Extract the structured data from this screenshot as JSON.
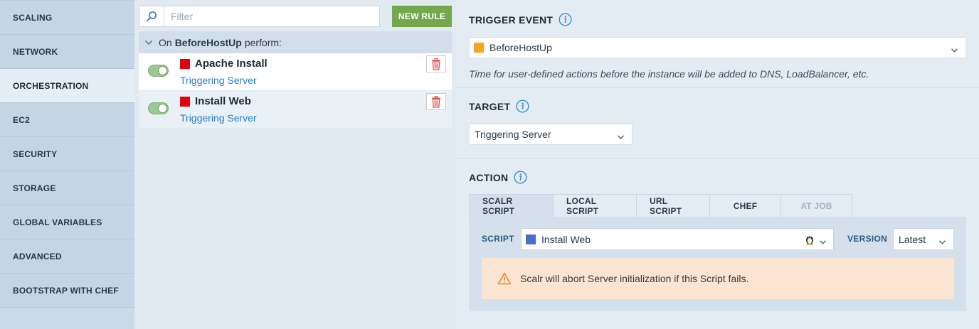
{
  "sidebar": {
    "items": [
      {
        "label": "SCALING"
      },
      {
        "label": "NETWORK"
      },
      {
        "label": "ORCHESTRATION"
      },
      {
        "label": "EC2"
      },
      {
        "label": "SECURITY"
      },
      {
        "label": "STORAGE"
      },
      {
        "label": "GLOBAL VARIABLES"
      },
      {
        "label": "ADVANCED"
      },
      {
        "label": "BOOTSTRAP WITH CHEF"
      }
    ],
    "active_index": 2
  },
  "rules_panel": {
    "filter_placeholder": "Filter",
    "new_rule_label": "NEW RULE",
    "header_prefix": "On",
    "header_event": "BeforeHostUp",
    "header_suffix": "perform:",
    "rules": [
      {
        "name": "Apache Install",
        "target": "Triggering Server",
        "enabled": true,
        "color": "#e0000f"
      },
      {
        "name": "Install Web",
        "target": "Triggering Server",
        "enabled": true,
        "color": "#e0000f"
      }
    ]
  },
  "trigger_event": {
    "title": "TRIGGER EVENT",
    "selected": "BeforeHostUp",
    "color": "#f5a51c",
    "description": "Time for user-defined actions before the instance will be added to DNS, LoadBalancer, etc."
  },
  "target": {
    "title": "TARGET",
    "selected": "Triggering Server"
  },
  "action": {
    "title": "ACTION",
    "tabs": [
      {
        "label": "SCALR SCRIPT",
        "active": true,
        "disabled": false
      },
      {
        "label": "LOCAL SCRIPT",
        "active": false,
        "disabled": false
      },
      {
        "label": "URL SCRIPT",
        "active": false,
        "disabled": false
      },
      {
        "label": "CHEF",
        "active": false,
        "disabled": false
      },
      {
        "label": "AT JOB",
        "active": false,
        "disabled": true
      }
    ],
    "script_label": "SCRIPT",
    "script_value": "Install Web",
    "script_color": "#4a6fc9",
    "version_label": "VERSION",
    "version_value": "Latest",
    "warning": "Scalr will abort Server initialization if this Script fails."
  },
  "icons": {
    "filter": "search-icon",
    "trash": "trash-icon",
    "info": "info-icon",
    "os": "linux-penguin-icon",
    "warning": "warning-triangle-icon"
  }
}
